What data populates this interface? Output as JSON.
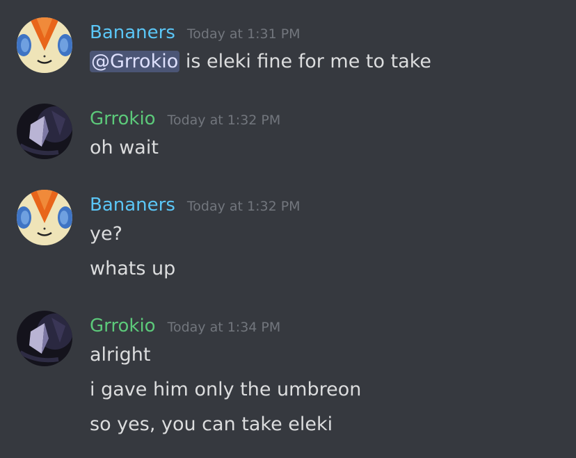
{
  "colors": {
    "background": "#36393f",
    "bananers_name": "#5bc6f6",
    "grrokio_name": "#5cc97a",
    "timestamp": "#72767d",
    "message_text": "#dcddde",
    "mention_bg": "#5b648f"
  },
  "messages": [
    {
      "author": "Bananers",
      "avatar_icon": "victini-avatar-icon",
      "timestamp": "Today at 1:31 PM",
      "lines": [
        {
          "mention": "@Grrokio",
          "text": " is eleki fine for me to take"
        }
      ]
    },
    {
      "author": "Grrokio",
      "avatar_icon": "dark-crystal-avatar-icon",
      "timestamp": "Today at 1:32 PM",
      "lines": [
        {
          "text": "oh wait"
        }
      ]
    },
    {
      "author": "Bananers",
      "avatar_icon": "victini-avatar-icon",
      "timestamp": "Today at 1:32 PM",
      "lines": [
        {
          "text": "ye?"
        },
        {
          "text": "whats up"
        }
      ]
    },
    {
      "author": "Grrokio",
      "avatar_icon": "dark-crystal-avatar-icon",
      "timestamp": "Today at 1:34 PM",
      "lines": [
        {
          "text": "alright"
        },
        {
          "text": "i gave him only the umbreon"
        },
        {
          "text": "so yes, you can take eleki"
        }
      ]
    }
  ]
}
